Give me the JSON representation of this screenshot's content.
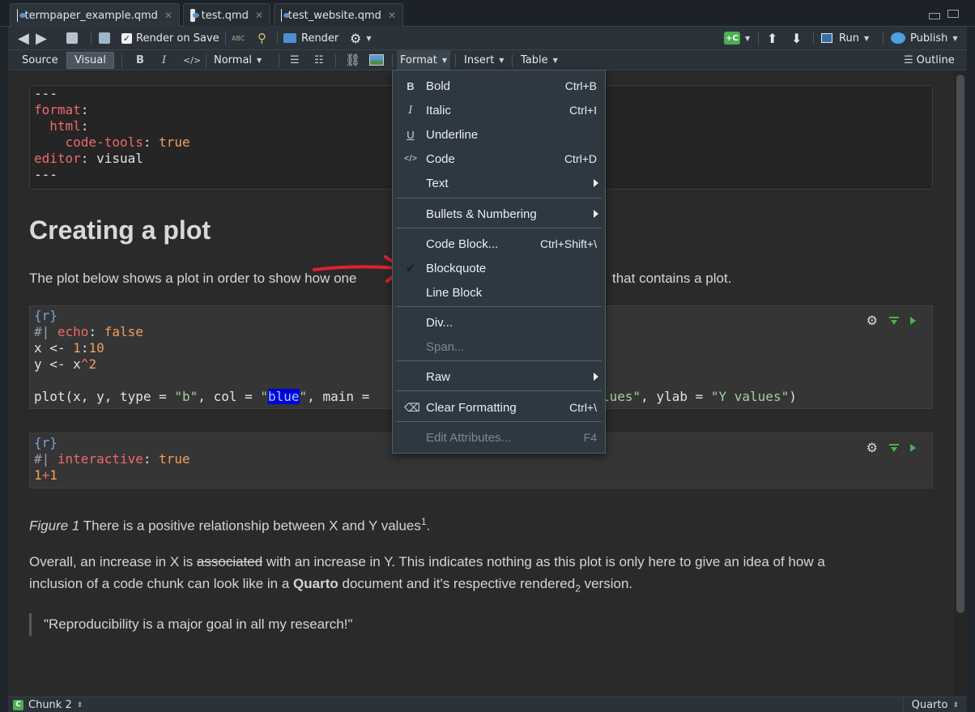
{
  "tabs": [
    {
      "label": "termpaper_example.qmd"
    },
    {
      "label": "test.qmd"
    },
    {
      "label": "test_website.qmd"
    }
  ],
  "toolbar": {
    "render_on_save": "Render on Save",
    "render": "Render",
    "run": "Run",
    "publish": "Publish",
    "source": "Source",
    "visual": "Visual",
    "bold": "B",
    "italic": "I",
    "code": "</>",
    "normal": "Normal",
    "format": "Format",
    "insert": "Insert",
    "table": "Table",
    "outline": "Outline"
  },
  "yaml": {
    "l1": "---",
    "format_key": "format",
    "html_key": "html",
    "codetools_key": "code-tools",
    "codetools_val": "true",
    "editor_key": "editor",
    "editor_val": "visual",
    "l6": "---"
  },
  "doc": {
    "heading": "Creating a plot",
    "para1_a": "The plot below shows a plot in order to show how one",
    "para1_b": "that contains a plot.",
    "figure_label": "Figure 1",
    "figure_text": " There is a positive relationship between X and Y values",
    "figure_sup": "1",
    "figure_end": ".",
    "para2_a": "Overall, an increase in X is ",
    "para2_strike": "associated",
    "para2_b": " with an increase in Y. This indicates nothing as this plot is only here to give an idea of how a",
    "para3_a": "inclusion of a code chunk can look like in a ",
    "para3_bold": "Quarto",
    "para3_b": " document and it's respective rendered",
    "para3_sub": "2",
    "para3_c": " version.",
    "blockquote": "\"Reproducibility is a major goal in all my research!\""
  },
  "chunk1": {
    "header": "{r}",
    "opt_prefix": "#| ",
    "opt_key": "echo",
    "opt_val": "false",
    "x_line_a": "x <- ",
    "x_line_b": "1",
    "x_line_c": ":",
    "x_line_d": "10",
    "y_line_a": "y <- x",
    "y_line_b": "^",
    "y_line_c": "2",
    "plot_a": "plot(x, y, type = ",
    "plot_type": "\"b\"",
    "plot_b": ", col = ",
    "plot_col_q1": "\"",
    "plot_col": "blue",
    "plot_col_q2": "\"",
    "plot_c": ", main = ",
    "plot_d": "lues\"",
    "plot_e": ", ylab = ",
    "plot_ylab": "\"Y values\"",
    "plot_f": ")"
  },
  "chunk2": {
    "header": "{r}",
    "opt_prefix": "#| ",
    "opt_key": "interactive",
    "opt_val": "true",
    "expr_a": "1",
    "expr_b": "+",
    "expr_c": "1"
  },
  "menu": {
    "bold": {
      "icon": "B",
      "label": "Bold",
      "shortcut": "Ctrl+B"
    },
    "italic": {
      "icon": "I",
      "label": "Italic",
      "shortcut": "Ctrl+I"
    },
    "underline": {
      "icon": "U",
      "label": "Underline"
    },
    "code": {
      "icon": "</>",
      "label": "Code",
      "shortcut": "Ctrl+D"
    },
    "text": {
      "label": "Text"
    },
    "bullets": {
      "label": "Bullets & Numbering"
    },
    "code_block": {
      "label": "Code Block...",
      "shortcut": "Ctrl+Shift+\\"
    },
    "blockquote": {
      "icon": "✔",
      "label": "Blockquote"
    },
    "line_block": {
      "label": "Line Block"
    },
    "div": {
      "label": "Div..."
    },
    "span": {
      "label": "Span..."
    },
    "raw": {
      "label": "Raw"
    },
    "clear_formatting": {
      "label": "Clear Formatting",
      "shortcut": "Ctrl+\\"
    },
    "edit_attributes": {
      "label": "Edit Attributes...",
      "shortcut": "F4"
    }
  },
  "status": {
    "chunk_badge": "C",
    "chunk_label": "Chunk 2",
    "mode": "Quarto"
  },
  "colors": {
    "accent_green": "#4caf50",
    "highlight_blue": "#0000d8",
    "arrow_red": "#e02030"
  }
}
